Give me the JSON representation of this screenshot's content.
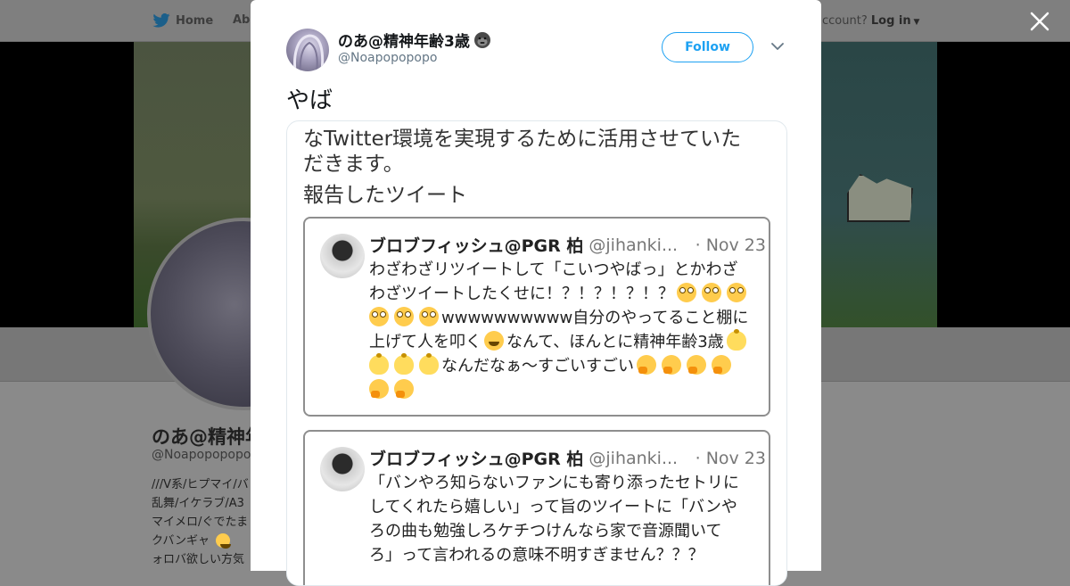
{
  "background": {
    "nav": {
      "home_label": "Home",
      "about_label": "Abo"
    },
    "login": {
      "prompt": "ccount?",
      "login_label": "Log in"
    },
    "profile": {
      "name": "のあ@精神年",
      "handle": "@Noapopopopo",
      "bio_lines": [
        "///V系/ヒプマイ/バ",
        "乱舞/イケラブ/A3",
        "マイメロ/ぐでたま",
        "クバンギャ",
        "ォロバ欲しい方気"
      ]
    }
  },
  "tweet": {
    "author_name": "のあ@精神年齢3歳",
    "author_handle": "@Noapopopopo",
    "follow_label": "Follow",
    "text": "やば",
    "media": {
      "line1": "なTwitter環境を実現するために活用させていた",
      "line2": "だきます。",
      "line3": "報告したツイート",
      "cards": [
        {
          "name": "ブロブフィッシュ@PGR 柏",
          "handle": "@jihanki...",
          "date": "· Nov 23",
          "line1": "わざわざリツイートして「こいつやばっ」とかわざ",
          "line2": "わざツイートしたくせに！？！？！？！？",
          "line3": "wwwwwwwwww自分のやってること棚に",
          "line4a": "上げて人を叩く",
          "line4b": "なんて、ほんとに精神年齢3歳",
          "line5": "なんだなぁ〜すごいすごい"
        },
        {
          "name": "ブロブフィッシュ@PGR 柏",
          "handle": "@jihanki...",
          "date": "· Nov 23",
          "line1": "「バンやろ知らないファンにも寄り添ったセトリに",
          "line2": "してくれたら嬉しい」って旨のツイートに「バンや",
          "line3": "ろの曲も勉強しろケチつけんなら家で音源聞いて",
          "line4": "ろ」って言われるの意味不明すぎません？？？"
        }
      ]
    }
  },
  "colors": {
    "accent": "#1da1f2",
    "muted": "#657786",
    "text": "#14171a"
  }
}
